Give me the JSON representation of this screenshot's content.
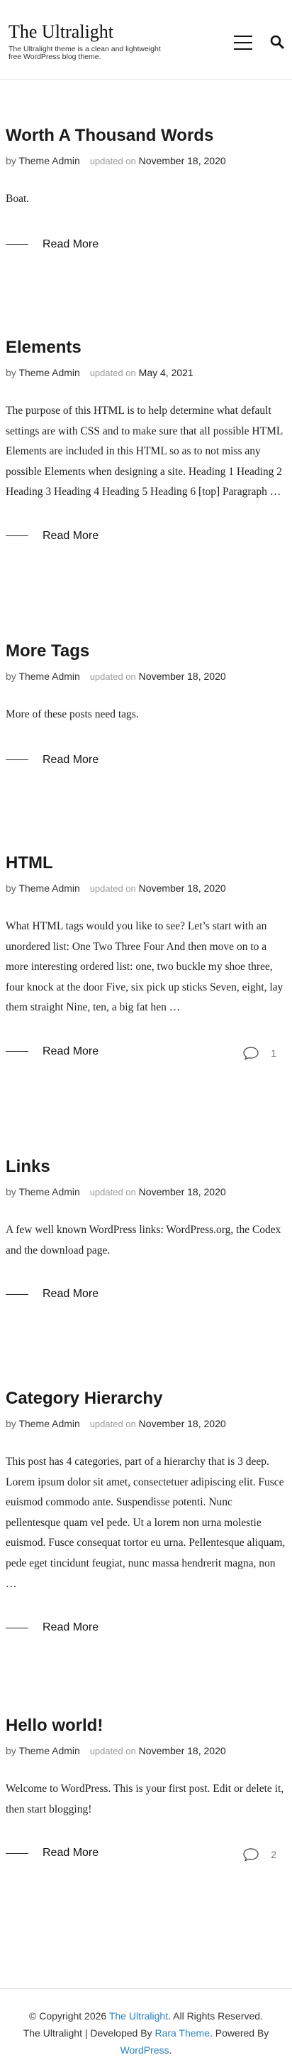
{
  "site": {
    "title": "The Ultralight",
    "description": "The Ultralight theme is a clean and lightweight free WordPress blog theme."
  },
  "meta_labels": {
    "by": "by",
    "updated": "updated on"
  },
  "read_more_label": "Read More",
  "posts": [
    {
      "title": "Worth A Thousand Words",
      "author": "Theme Admin",
      "date": "November 18, 2020",
      "excerpt": "Boat.",
      "comments": ""
    },
    {
      "title": "Elements",
      "author": "Theme Admin",
      "date": "May 4, 2021",
      "excerpt": "The purpose of this HTML is to help determine what default settings are with CSS and to make sure that all possible HTML Elements are included in this HTML so as to not miss any possible Elements when designing a site. Heading 1 Heading 2 Heading 3 Heading 4 Heading 5 Heading 6 [top] Paragraph …",
      "comments": ""
    },
    {
      "title": "More Tags",
      "author": "Theme Admin",
      "date": "November 18, 2020",
      "excerpt": "More of these posts need tags.",
      "comments": ""
    },
    {
      "title": "HTML",
      "author": "Theme Admin",
      "date": "November 18, 2020",
      "excerpt": "What HTML tags would you like to see? Let’s start with an unordered list: One Two Three Four And then move on to a more interesting ordered list: one, two buckle my shoe three, four knock at the door Five, six pick up sticks Seven, eight, lay them straight Nine, ten, a big fat hen …",
      "comments": "1"
    },
    {
      "title": "Links",
      "author": "Theme Admin",
      "date": "November 18, 2020",
      "excerpt": "A few well known WordPress links: WordPress.org, the Codex and the download page.",
      "comments": ""
    },
    {
      "title": "Category Hierarchy",
      "author": "Theme Admin",
      "date": "November 18, 2020",
      "excerpt": "This post has 4 categories, part of a hierarchy that is 3 deep. Lorem ipsum dolor sit amet, consectetuer adipiscing elit. Fusce euismod commodo ante. Suspendisse potenti. Nunc pellentesque quam vel pede. Ut a lorem non urna molestie euismod. Fusce consequat tortor eu urna. Pellentesque aliquam, pede eget tincidunt feugiat, nunc massa hendrerit magna, non …",
      "comments": ""
    },
    {
      "title": "Hello world!",
      "author": "Theme Admin",
      "date": "November 18, 2020",
      "excerpt": "Welcome to WordPress. This is your first post. Edit or delete it, then start blogging!",
      "comments": "2"
    }
  ],
  "footer": {
    "copyright_prefix": "© Copyright 2026",
    "copyright_link": "The Ultralight",
    "copyright_suffix": ". All Rights Reserved.",
    "dev_prefix": "The Ultralight | Developed By",
    "dev_link": "Rara Theme",
    "powered_prefix": ". Powered By",
    "powered_link": "WordPress",
    "powered_suffix": "."
  }
}
